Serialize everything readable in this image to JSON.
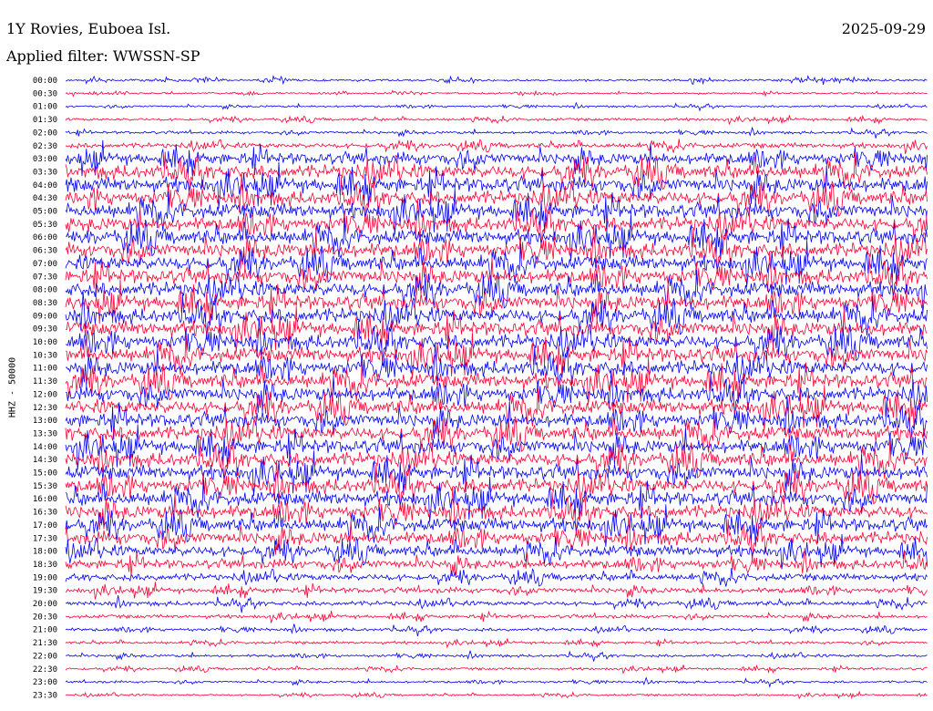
{
  "header": {
    "title": "1Y Rovies, Euboea Isl.",
    "date": "2025-09-29",
    "filter": "Applied filter: WWSSN-SP"
  },
  "chart_data": {
    "type": "line",
    "ylabel": "HHZ - 50000",
    "row_labels": [
      "00:00",
      "00:30",
      "01:00",
      "01:30",
      "02:00",
      "02:30",
      "03:00",
      "03:30",
      "04:00",
      "04:30",
      "05:00",
      "05:30",
      "06:00",
      "06:30",
      "07:00",
      "07:30",
      "08:00",
      "08:30",
      "09:00",
      "09:30",
      "10:00",
      "10:30",
      "11:00",
      "11:30",
      "12:00",
      "12:30",
      "13:00",
      "13:30",
      "14:00",
      "14:30",
      "15:00",
      "15:30",
      "16:00",
      "16:30",
      "17:00",
      "17:30",
      "18:00",
      "18:30",
      "19:00",
      "19:30",
      "20:00",
      "20:30",
      "21:00",
      "21:30",
      "22:00",
      "22:30",
      "23:00",
      "23:30"
    ],
    "trace_colors": [
      "#0000ff",
      "#ff0033"
    ],
    "relative_amplitude": [
      0.25,
      0.2,
      0.22,
      0.3,
      0.3,
      0.55,
      1.3,
      1.5,
      1.6,
      1.55,
      1.6,
      1.55,
      1.6,
      1.6,
      1.6,
      1.6,
      1.6,
      1.6,
      1.6,
      1.6,
      1.6,
      1.6,
      1.6,
      1.6,
      1.55,
      1.55,
      1.55,
      1.55,
      1.55,
      1.55,
      1.55,
      1.55,
      1.55,
      1.5,
      1.45,
      1.4,
      1.2,
      1.0,
      0.75,
      0.6,
      0.5,
      0.4,
      0.35,
      0.3,
      0.3,
      0.28,
      0.25,
      0.22
    ]
  }
}
